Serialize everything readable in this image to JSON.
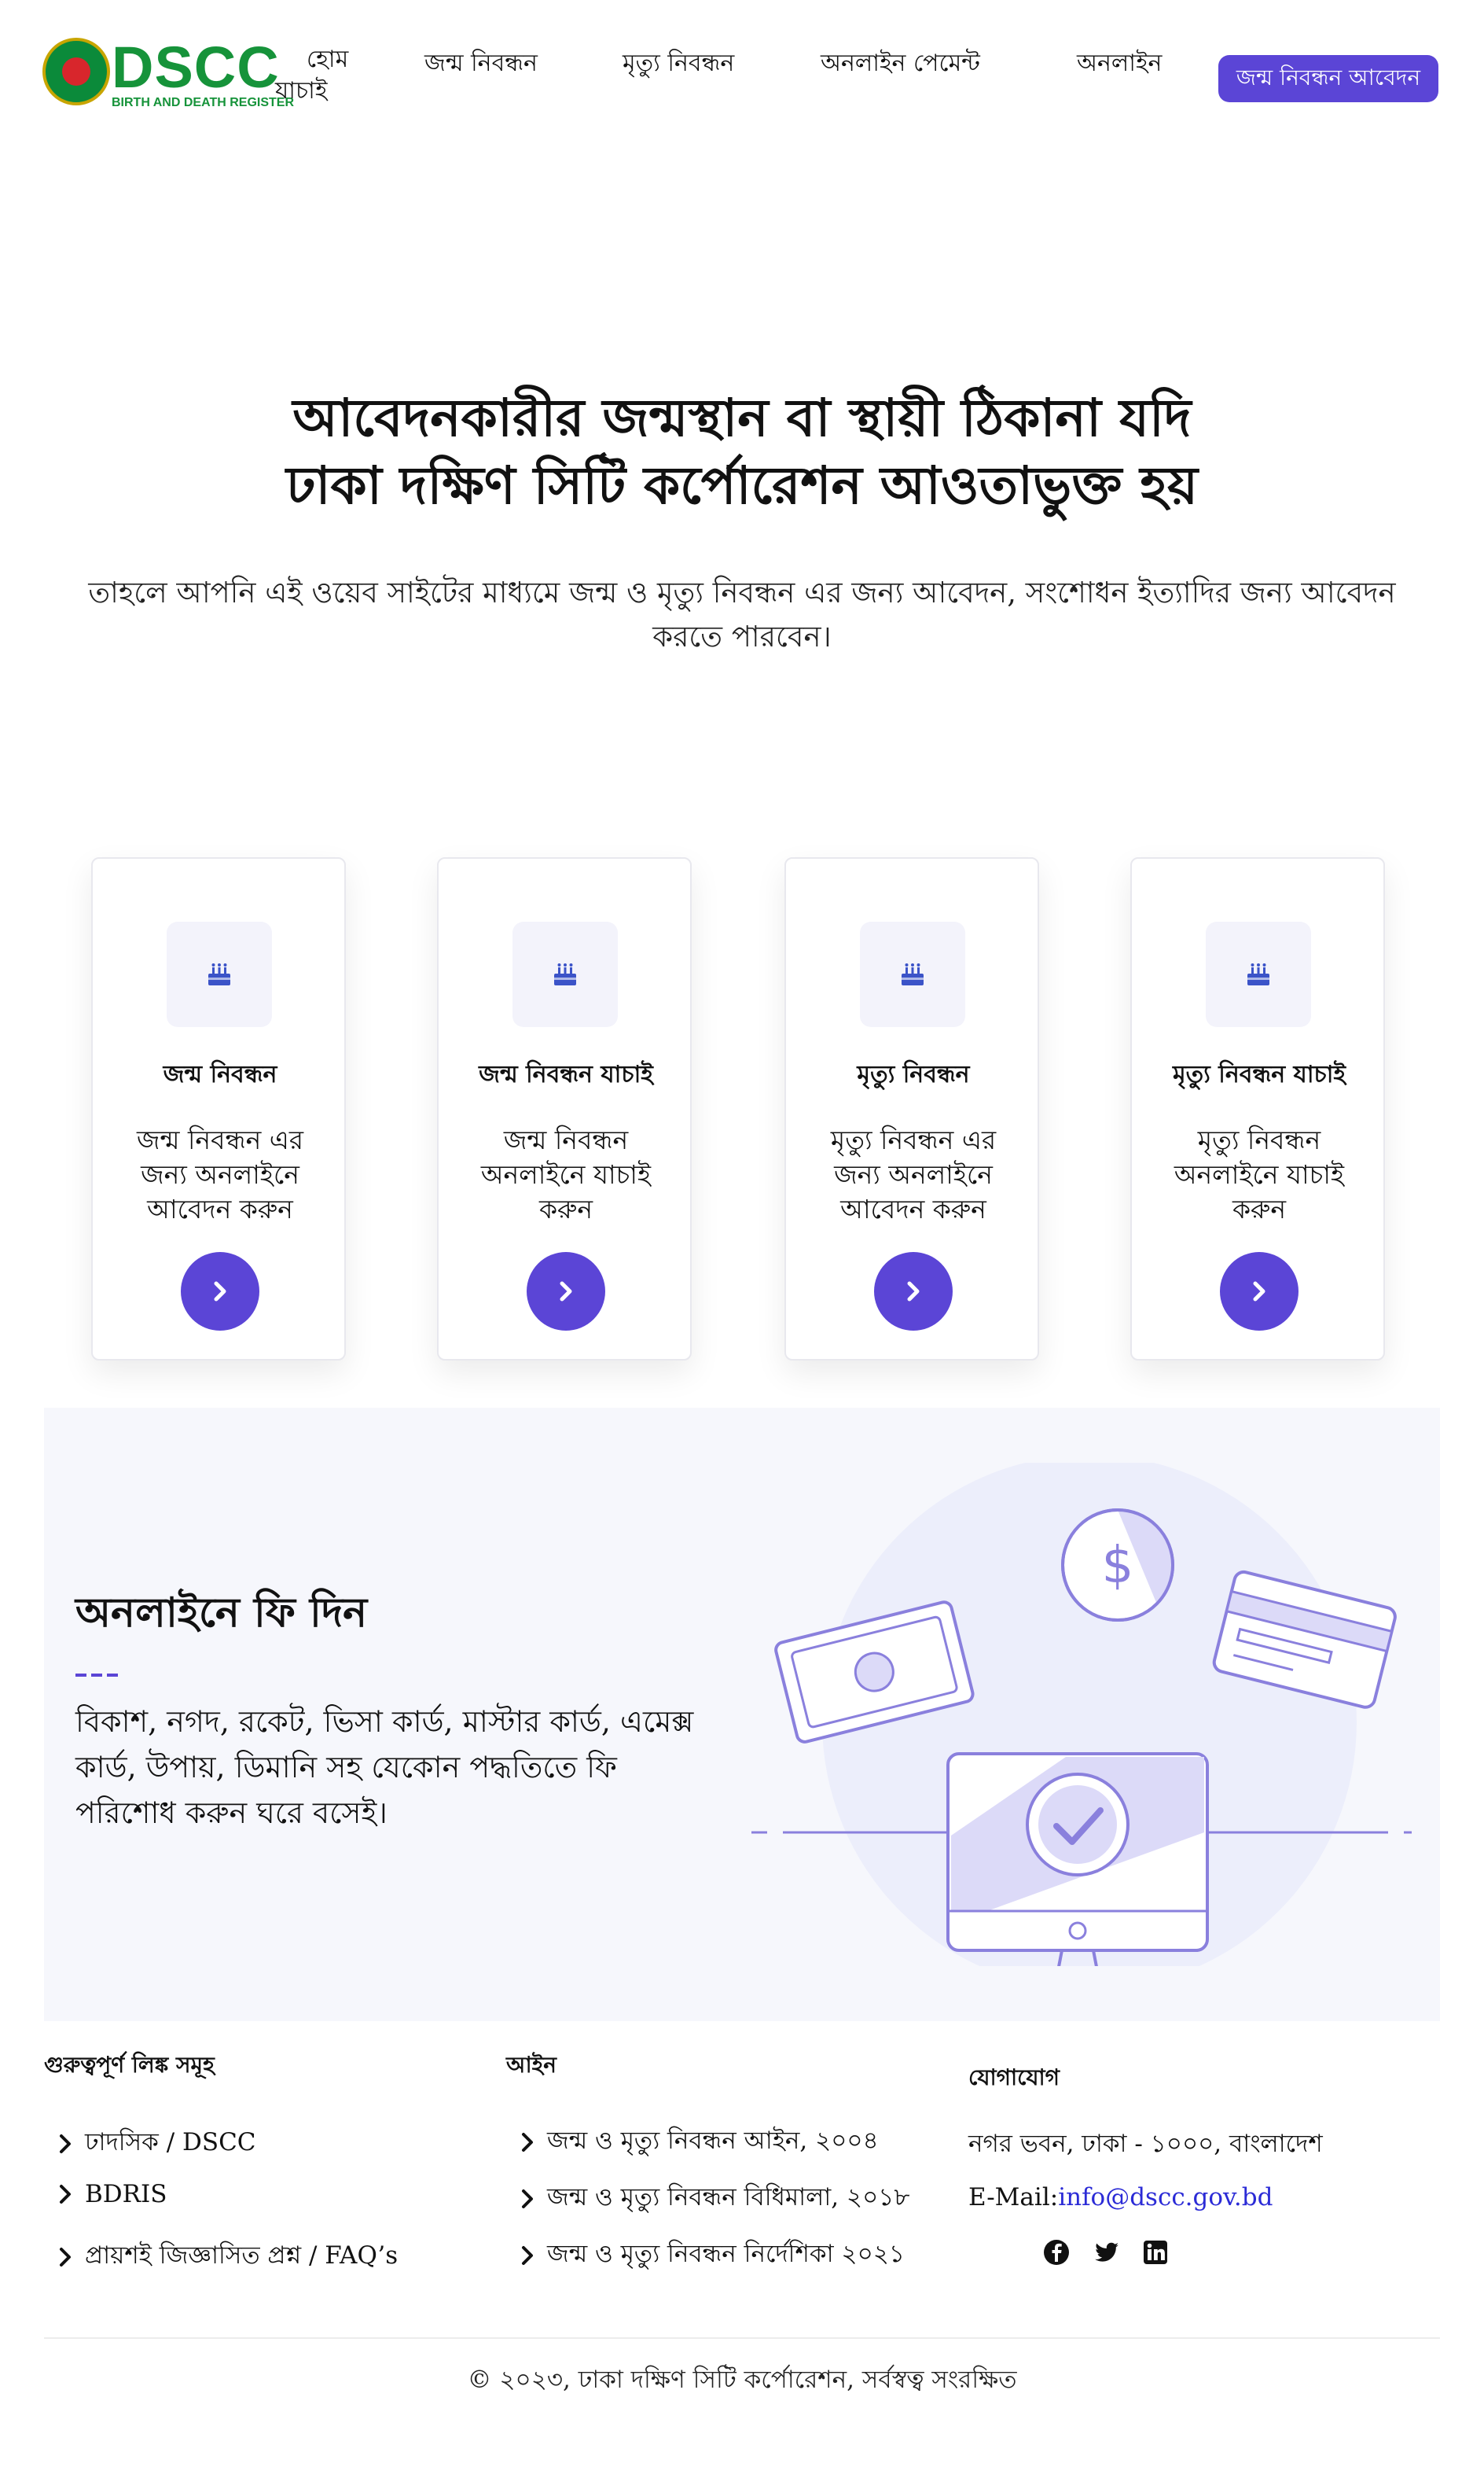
{
  "header": {
    "logo_text": "DSCC",
    "logo_sub": "BIRTH AND DEATH REGISTER",
    "nav": {
      "home_line1": "হোম",
      "home_line2": "যাচাই",
      "birth": "জন্ম নিবন্ধন",
      "death": "মৃত্যু নিবন্ধন",
      "payment": "অনলাইন পেমেন্ট",
      "online": "অনলাইন"
    },
    "cta": "জন্ম নিবন্ধন আবেদন"
  },
  "hero": {
    "title_line1": "আবেদনকারীর জন্মস্থান বা স্থায়ী ঠিকানা যদি",
    "title_line2": "ঢাকা দক্ষিণ সিটি কর্পোরেশন আওতাভুক্ত হয়",
    "subtitle": "তাহলে আপনি এই ওয়েব সাইটের মাধ্যমে জন্ম ও মৃত্যু নিবন্ধন এর জন্য আবেদন, সংশোধন ইত্যাদির জন্য আবেদন করতে পারবেন।"
  },
  "cards": [
    {
      "title": "জন্ম নিবন্ধন",
      "desc": "জন্ম নিবন্ধন এর জন্য অনলাইনে আবেদন করুন",
      "icon": "cake-icon"
    },
    {
      "title": "জন্ম নিবন্ধন যাচাই",
      "desc": "জন্ম নিবন্ধন অনলাইনে যাচাই করুন",
      "icon": "cake-icon"
    },
    {
      "title": "মৃত্যু নিবন্ধন",
      "desc": "মৃত্যু নিবন্ধন এর জন্য অনলাইনে আবেদন করুন",
      "icon": "cake-icon"
    },
    {
      "title": "মৃত্যু নিবন্ধন যাচাই",
      "desc": "মৃত্যু নিবন্ধন অনলাইনে যাচাই করুন",
      "icon": "cake-icon"
    }
  ],
  "payment": {
    "title": "অনলাইনে ফি দিন",
    "text": "বিকাশ, নগদ, রকেট, ভিসা কার্ড, মাস্টার কার্ড, এমেক্স কার্ড, উপায়, ডিমানি সহ যেকোন পদ্ধতিতে ফি পরিশোধ করুন ঘরে বসেই।"
  },
  "footer": {
    "links_heading": "গুরুত্বপূর্ণ লিঙ্ক সমূহ",
    "links": [
      "ঢাদসিক / DSCC",
      "BDRIS",
      "প্রায়শই জিজ্ঞাসিত প্রশ্ন / FAQ’s"
    ],
    "law_heading": "আইন",
    "laws": [
      "জন্ম ও মৃত্যু নিবন্ধন আইন, ২০০৪",
      "জন্ম ও মৃত্যু নিবন্ধন বিধিমালা, ২০১৮",
      "জন্ম ও মৃত্যু নিবন্ধন নির্দেশিকা ২০২১"
    ],
    "contact_heading": "যোগাযোগ",
    "address": "নগর ভবন, ঢাকা - ১০০০, বাংলাদেশ",
    "email_label": "E-Mail:",
    "email": "info@dscc.gov.bd",
    "copyright": "© ২০২৩, ঢাকা দক্ষিণ সিটি কর্পোরেশন, সর্বস্বত্ব সংরক্ষিত"
  },
  "colors": {
    "accent": "#5b45d6",
    "brand_green": "#16933a",
    "section_bg": "#f6f7fc"
  }
}
